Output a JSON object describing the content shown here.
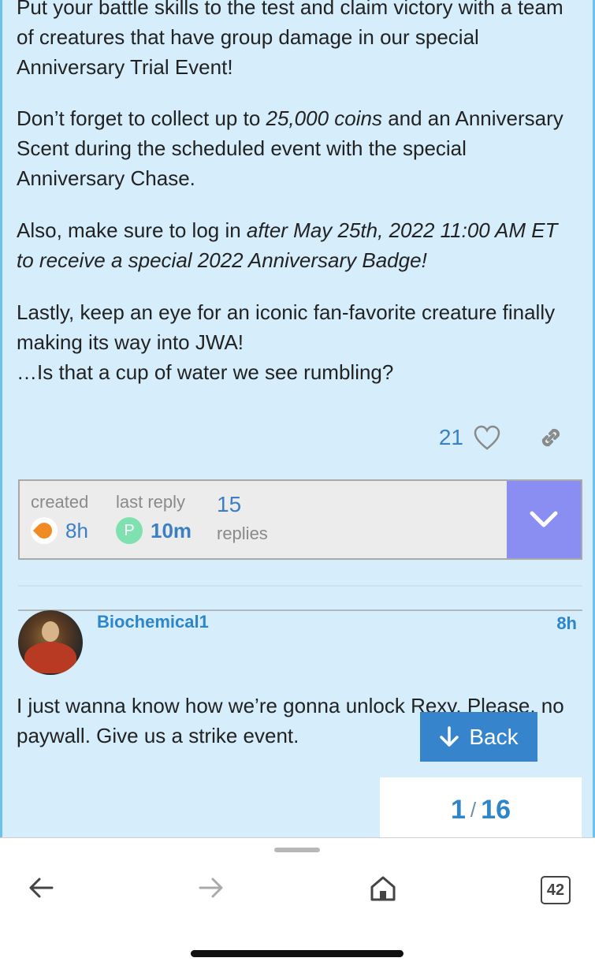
{
  "post": {
    "p1": "Put your battle skills to the test and claim victory with a team of creatures that have group damage in our special Anniversary Trial Event!",
    "p2_a": "Don’t forget to collect up to ",
    "p2_italic": "25,000 coins",
    "p2_b": " and an Anniversary Scent during the scheduled event with the special Anniversary Chase.",
    "p3_a": "Also, make sure to log in ",
    "p3_italic": "after May 25th, 2022 11:00 AM ET to receive a special 2022 Anniversary Badge!",
    "p4_line1": "Lastly, keep an eye for an iconic fan-favorite creature finally making its way into JWA!",
    "p4_line2": "…Is that a cup of water we see rumbling?",
    "like_count": "21"
  },
  "topic_map": {
    "created_label": "created",
    "created_value": "8h",
    "last_reply_label": "last reply",
    "last_reply_avatar_letter": "P",
    "last_reply_value": "10m",
    "replies_count": "15",
    "replies_label": "replies"
  },
  "reply": {
    "username": "Biochemical1",
    "age": "8h",
    "body": "I just wanna know how we’re gonna unlock Rexy. Please, no paywall. Give us a strike event."
  },
  "controls": {
    "back_label": "Back",
    "progress_current": "1",
    "progress_separator": "/",
    "progress_total": "16"
  },
  "browser": {
    "tab_count": "42"
  },
  "colors": {
    "page_bg": "#d6eefc",
    "accent_blue": "#2e86c8",
    "expand_purple": "#8a8df2",
    "back_button": "#3685cc"
  }
}
